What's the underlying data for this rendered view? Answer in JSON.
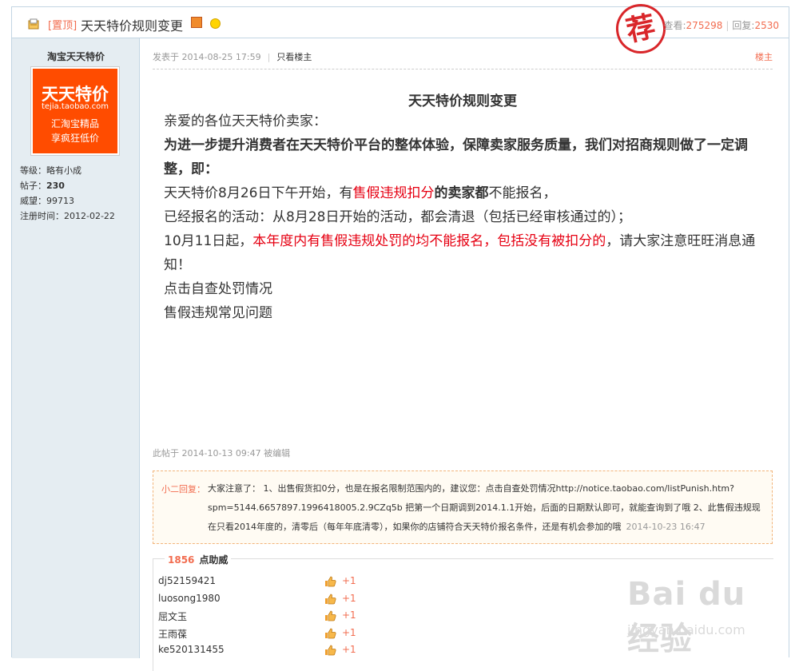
{
  "header": {
    "prefix": "[置顶]",
    "title": "天天特价规则变更",
    "views_label": "查看:",
    "views": "275298",
    "replies_label": "回复:",
    "replies": "2530",
    "stamp": "荐"
  },
  "author": {
    "name": "淘宝天天特价",
    "logo_main": "天天特价",
    "logo_sub": "tejia.taobao.com",
    "logo_tag1": "汇淘宝精品",
    "logo_tag2": "享疯狂低价",
    "level": "等级：略有小成",
    "posts_label": "帖子：",
    "posts": "230",
    "prestige": "威望：99713",
    "reg_time": "注册时间：2012-02-22"
  },
  "post": {
    "posted": "发表于 2014-08-25 17:59",
    "only_author": "只看楼主",
    "floor": "楼主",
    "title": "天天特价规则变更",
    "line1": "亲爱的各位天天特价卖家：",
    "line2": "为进一步提升消费者在天天特价平台的整体体验，保障卖家服务质量，我们对招商规则做了一定调整，即：",
    "line3_a": "天天特价8月26日下午开始，有",
    "line3_b": "售假违规扣分",
    "line3_c": "的卖家",
    "line3_d": "都",
    "line3_e": "不能报名，",
    "line4": "已经报名的活动：从8月28日开始的活动，都会清退（包括已经审核通过的）；",
    "line5_a": "10月11日起，",
    "line5_b": "本年度内有售假违规处罚的均不能报名，包括没有被扣分的",
    "line5_c": "，请大家注意旺旺消息通知！",
    "line6": "点击自查处罚情况",
    "line7": "售假违规常见问题",
    "edited": "此帖于 2014-10-13 09:47 被编辑"
  },
  "reply": {
    "label": "小二回复：",
    "text": "大家注意了： 1、出售假货扣0分，也是在报名限制范围内的，建议您：点击自查处罚情况http://notice.taobao.com/listPunish.htm?spm=5144.6657897.1996418005.2.9CZq5b 把第一个日期调到2014.1.1开始，后面的日期默认即可，就能查询到了哦 2、此售假违规现在只看2014年度的，清零后（每年年底清零），如果你的店铺符合天天特价报名条件，还是有机会参加的哦",
    "time": "2014-10-23 16:47"
  },
  "rating": {
    "count": "1856",
    "label": "点助威",
    "plus": "+1",
    "users": [
      "dj52159421",
      "luosong1980",
      "屈文玉",
      "王雨葆",
      "ke520131455"
    ]
  },
  "watermark": {
    "logo": "Bai du 经验",
    "url": "jingyan.baidu.com"
  }
}
